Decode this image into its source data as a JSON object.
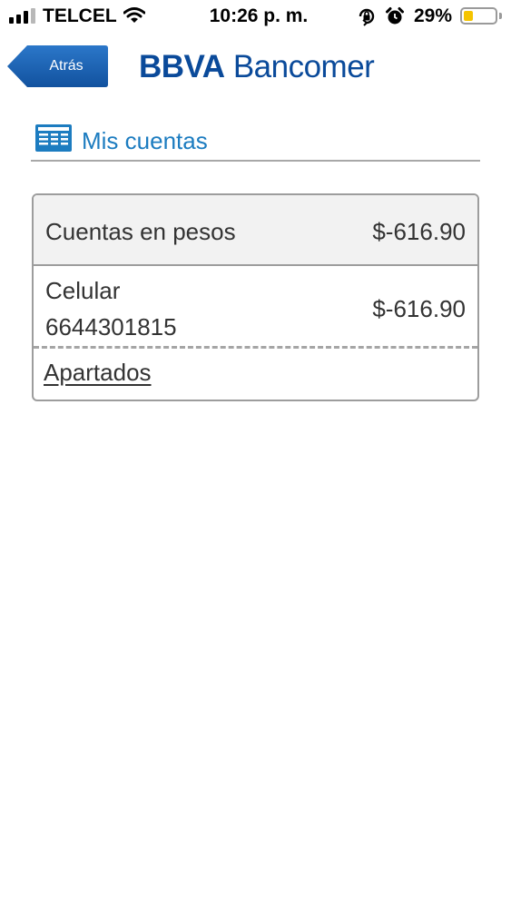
{
  "status_bar": {
    "carrier": "TELCEL",
    "time": "10:26 p. m.",
    "battery_percent": "29%",
    "battery_level": 0.29,
    "signal_bars": 3,
    "icons": [
      "signal-icon",
      "wifi-icon",
      "orientation-lock-icon",
      "alarm-icon",
      "battery-icon"
    ]
  },
  "header": {
    "back_label": "Atrás",
    "brand_bold": "BBVA",
    "brand_light": "Bancomer",
    "colors": {
      "back_button": "#1a5fb0",
      "brand": "#0a4a9a"
    }
  },
  "section": {
    "title": "Mis cuentas",
    "icon": "accounts-list-icon",
    "title_color": "#1c7cc0"
  },
  "accounts": {
    "group_label": "Cuentas en pesos",
    "group_total": "$-616.90",
    "items": [
      {
        "name": "Celular",
        "number": "6644301815",
        "balance": "$-616.90"
      }
    ],
    "apartados_link": "Apartados"
  }
}
